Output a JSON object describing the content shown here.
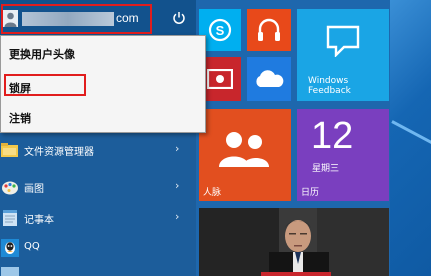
{
  "user": {
    "name_suffix": "com"
  },
  "user_menu": {
    "items": [
      {
        "label": "更换用户头像"
      },
      {
        "label": "锁屏"
      },
      {
        "label": "注销"
      }
    ]
  },
  "apps": [
    {
      "label": "文件资源管理器",
      "icon": "folder-icon",
      "has_submenu": true
    },
    {
      "label": "画图",
      "icon": "paint-icon",
      "has_submenu": true
    },
    {
      "label": "记事本",
      "icon": "notepad-icon",
      "has_submenu": true
    },
    {
      "label": "QQ",
      "icon": "qq-icon",
      "has_submenu": false
    }
  ],
  "tiles": {
    "windows_feedback": "Windows\nFeedback",
    "people": "人脉",
    "calendar": {
      "day": "12",
      "weekday": "星期三",
      "label": "日历"
    }
  },
  "colors": {
    "start_bg": "#1c5d9b",
    "highlight_red": "#e11d1d",
    "skype": "#00aff0",
    "music": "#e8491a",
    "video": "#c8262c",
    "onedrive": "#1f7be0",
    "feedback": "#1aa5e5",
    "people": "#e24f1f",
    "calendar": "#7a3fbf"
  }
}
